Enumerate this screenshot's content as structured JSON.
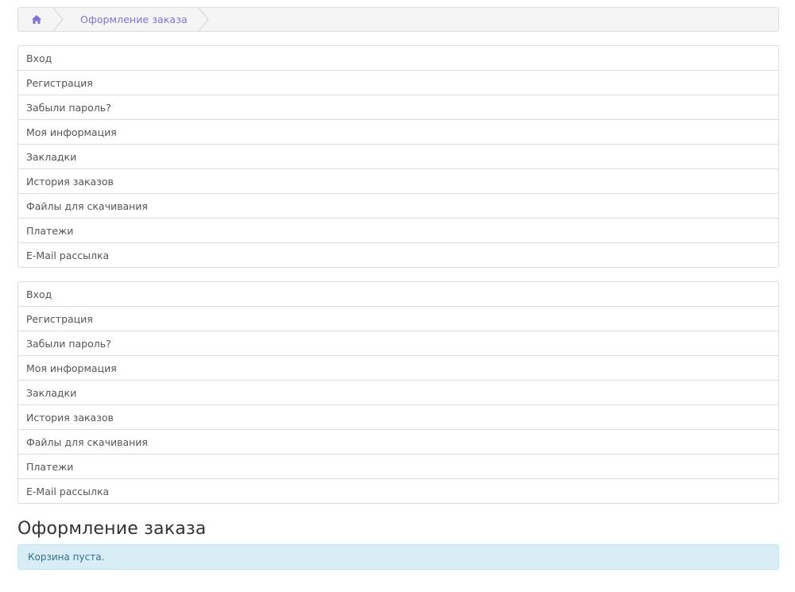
{
  "breadcrumb": {
    "home_icon": "home-icon",
    "current": "Оформление заказа"
  },
  "account_menu_1": {
    "items": [
      {
        "label": "Вход"
      },
      {
        "label": "Регистрация"
      },
      {
        "label": "Забыли пароль?"
      },
      {
        "label": "Моя информация"
      },
      {
        "label": "Закладки"
      },
      {
        "label": "История заказов"
      },
      {
        "label": "Файлы для скачивания"
      },
      {
        "label": "Платежи"
      },
      {
        "label": "E-Mail рассылка"
      }
    ]
  },
  "account_menu_2": {
    "items": [
      {
        "label": "Вход"
      },
      {
        "label": "Регистрация"
      },
      {
        "label": "Забыли пароль?"
      },
      {
        "label": "Моя информация"
      },
      {
        "label": "Закладки"
      },
      {
        "label": "История заказов"
      },
      {
        "label": "Файлы для скачивания"
      },
      {
        "label": "Платежи"
      },
      {
        "label": "E-Mail рассылка"
      }
    ]
  },
  "main": {
    "title": "Оформление заказа",
    "alert": "Корзина пуста."
  },
  "colors": {
    "accent": "#7b74d6",
    "alert_bg": "#d9edf7",
    "alert_text": "#31708f"
  }
}
